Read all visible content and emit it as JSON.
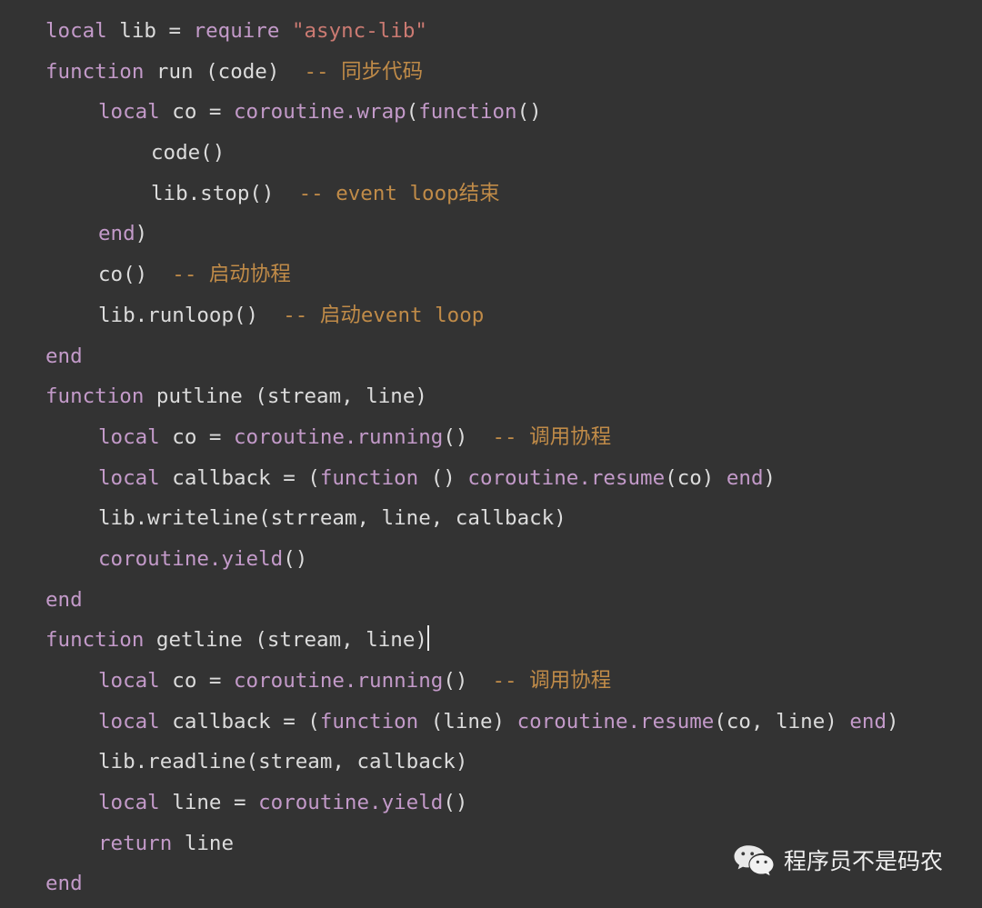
{
  "editor": {
    "background_color": "#333333",
    "default_text_color": "#dcdcdc",
    "keyword_color": "#c39ac9",
    "string_color": "#cb7a72",
    "comment_color": "#c08b48",
    "language": "lua",
    "caret_line_index": 15,
    "lines": [
      {
        "indent": 0,
        "tokens": [
          {
            "t": "kw",
            "s": "local"
          },
          {
            "t": "plain",
            "s": " lib = "
          },
          {
            "t": "kw",
            "s": "require"
          },
          {
            "t": "plain",
            "s": " "
          },
          {
            "t": "str",
            "s": "\"async-lib\""
          }
        ]
      },
      {
        "indent": 0,
        "tokens": [
          {
            "t": "kw",
            "s": "function"
          },
          {
            "t": "plain",
            "s": " run (code)  "
          },
          {
            "t": "cmt",
            "s": "-- 同步代码"
          }
        ]
      },
      {
        "indent": 1,
        "tokens": [
          {
            "t": "kw",
            "s": "local"
          },
          {
            "t": "plain",
            "s": " co = "
          },
          {
            "t": "kw",
            "s": "coroutine.wrap"
          },
          {
            "t": "plain",
            "s": "("
          },
          {
            "t": "kw",
            "s": "function"
          },
          {
            "t": "plain",
            "s": "()"
          }
        ]
      },
      {
        "indent": 2,
        "tokens": [
          {
            "t": "plain",
            "s": "code()"
          }
        ]
      },
      {
        "indent": 2,
        "tokens": [
          {
            "t": "plain",
            "s": "lib.stop()  "
          },
          {
            "t": "cmt",
            "s": "-- event loop结束"
          }
        ]
      },
      {
        "indent": 1,
        "tokens": [
          {
            "t": "kw",
            "s": "end"
          },
          {
            "t": "plain",
            "s": ")"
          }
        ]
      },
      {
        "indent": 1,
        "tokens": [
          {
            "t": "plain",
            "s": "co()  "
          },
          {
            "t": "cmt",
            "s": "-- 启动协程"
          }
        ]
      },
      {
        "indent": 1,
        "tokens": [
          {
            "t": "plain",
            "s": "lib.runloop()  "
          },
          {
            "t": "cmt",
            "s": "-- 启动event loop"
          }
        ]
      },
      {
        "indent": 0,
        "tokens": [
          {
            "t": "kw",
            "s": "end"
          }
        ]
      },
      {
        "indent": 0,
        "tokens": [
          {
            "t": "kw",
            "s": "function"
          },
          {
            "t": "plain",
            "s": " putline (stream, line)"
          }
        ]
      },
      {
        "indent": 1,
        "tokens": [
          {
            "t": "kw",
            "s": "local"
          },
          {
            "t": "plain",
            "s": " co = "
          },
          {
            "t": "kw",
            "s": "coroutine.running"
          },
          {
            "t": "plain",
            "s": "()  "
          },
          {
            "t": "cmt",
            "s": "-- 调用协程"
          }
        ]
      },
      {
        "indent": 1,
        "tokens": [
          {
            "t": "kw",
            "s": "local"
          },
          {
            "t": "plain",
            "s": " callback = ("
          },
          {
            "t": "kw",
            "s": "function"
          },
          {
            "t": "plain",
            "s": " () "
          },
          {
            "t": "kw",
            "s": "coroutine.resume"
          },
          {
            "t": "plain",
            "s": "(co) "
          },
          {
            "t": "kw",
            "s": "end"
          },
          {
            "t": "plain",
            "s": ")"
          }
        ]
      },
      {
        "indent": 1,
        "tokens": [
          {
            "t": "plain",
            "s": "lib.writeline(strream, line, callback)"
          }
        ]
      },
      {
        "indent": 1,
        "tokens": [
          {
            "t": "kw",
            "s": "coroutine.yield"
          },
          {
            "t": "plain",
            "s": "()"
          }
        ]
      },
      {
        "indent": 0,
        "tokens": [
          {
            "t": "kw",
            "s": "end"
          }
        ]
      },
      {
        "indent": 0,
        "tokens": [
          {
            "t": "kw",
            "s": "function"
          },
          {
            "t": "plain",
            "s": " getline (stream, line)"
          }
        ]
      },
      {
        "indent": 1,
        "tokens": [
          {
            "t": "kw",
            "s": "local"
          },
          {
            "t": "plain",
            "s": " co = "
          },
          {
            "t": "kw",
            "s": "coroutine.running"
          },
          {
            "t": "plain",
            "s": "()  "
          },
          {
            "t": "cmt",
            "s": "-- 调用协程"
          }
        ]
      },
      {
        "indent": 1,
        "tokens": [
          {
            "t": "kw",
            "s": "local"
          },
          {
            "t": "plain",
            "s": " callback = ("
          },
          {
            "t": "kw",
            "s": "function"
          },
          {
            "t": "plain",
            "s": " (line) "
          },
          {
            "t": "kw",
            "s": "coroutine.resume"
          },
          {
            "t": "plain",
            "s": "(co, line) "
          },
          {
            "t": "kw",
            "s": "end"
          },
          {
            "t": "plain",
            "s": ")"
          }
        ]
      },
      {
        "indent": 1,
        "tokens": [
          {
            "t": "plain",
            "s": "lib.readline(stream, callback)"
          }
        ]
      },
      {
        "indent": 1,
        "tokens": [
          {
            "t": "kw",
            "s": "local"
          },
          {
            "t": "plain",
            "s": " line = "
          },
          {
            "t": "kw",
            "s": "coroutine.yield"
          },
          {
            "t": "plain",
            "s": "()"
          }
        ]
      },
      {
        "indent": 1,
        "tokens": [
          {
            "t": "kw",
            "s": "return"
          },
          {
            "t": "plain",
            "s": " line"
          }
        ]
      },
      {
        "indent": 0,
        "tokens": [
          {
            "t": "kw",
            "s": "end"
          }
        ]
      }
    ]
  },
  "watermark": {
    "icon": "wechat-icon",
    "label": "程序员不是码农",
    "color": "#efefef"
  }
}
